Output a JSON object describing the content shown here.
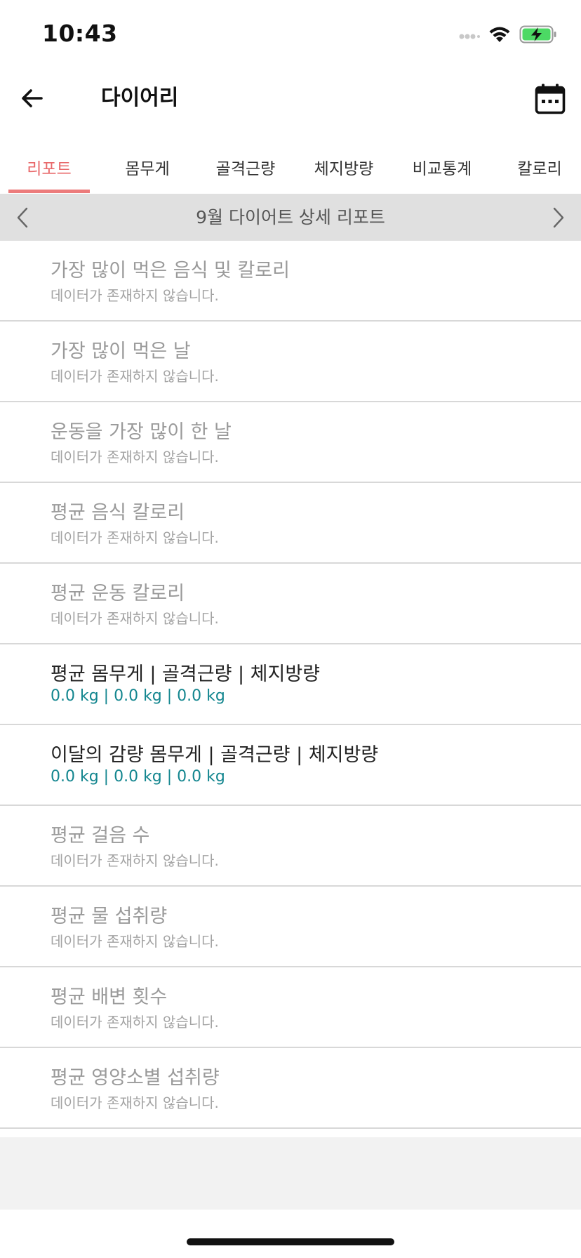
{
  "status_bar": {
    "time": "10:43"
  },
  "header": {
    "title": "다이어리"
  },
  "tabs": [
    {
      "label": "리포트",
      "active": true
    },
    {
      "label": "몸무게",
      "active": false
    },
    {
      "label": "골격근량",
      "active": false
    },
    {
      "label": "체지방량",
      "active": false
    },
    {
      "label": "비교통계",
      "active": false
    },
    {
      "label": "칼로리",
      "active": false
    }
  ],
  "month_nav": {
    "title": "9월 다이어트 상세 리포트"
  },
  "report_items": [
    {
      "title": "가장 많이 먹은 음식 및 칼로리",
      "value": "데이터가 존재하지 않습니다.",
      "has_data": false
    },
    {
      "title": "가장 많이 먹은 날",
      "value": "데이터가 존재하지 않습니다.",
      "has_data": false
    },
    {
      "title": "운동을 가장 많이 한 날",
      "value": "데이터가 존재하지 않습니다.",
      "has_data": false
    },
    {
      "title": "평균 음식 칼로리",
      "value": "데이터가 존재하지 않습니다.",
      "has_data": false
    },
    {
      "title": "평균 운동 칼로리",
      "value": "데이터가 존재하지 않습니다.",
      "has_data": false
    },
    {
      "title": "평균 몸무게 | 골격근량 | 체지방량",
      "value": "0.0 kg | 0.0 kg | 0.0 kg",
      "has_data": true
    },
    {
      "title": "이달의 감량 몸무게 | 골격근량 | 체지방량",
      "value": "0.0 kg | 0.0 kg | 0.0 kg",
      "has_data": true
    },
    {
      "title": "평균 걸음 수",
      "value": "데이터가 존재하지 않습니다.",
      "has_data": false
    },
    {
      "title": "평균 물 섭취량",
      "value": "데이터가 존재하지 않습니다.",
      "has_data": false
    },
    {
      "title": "평균 배변 횟수",
      "value": "데이터가 존재하지 않습니다.",
      "has_data": false
    },
    {
      "title": "평균 영양소별 섭취량",
      "value": "데이터가 존재하지 않습니다.",
      "has_data": false
    }
  ],
  "colors": {
    "tab_active": "#e8686a",
    "data_value": "#13868f",
    "battery_fill": "#4cd964"
  },
  "icons": {
    "back": "arrow-left-icon",
    "calendar": "calendar-icon",
    "prev": "chevron-left-icon",
    "next": "chevron-right-icon",
    "cellular": "cellular-signal-icon",
    "wifi": "wifi-icon",
    "battery": "battery-charging-icon"
  }
}
